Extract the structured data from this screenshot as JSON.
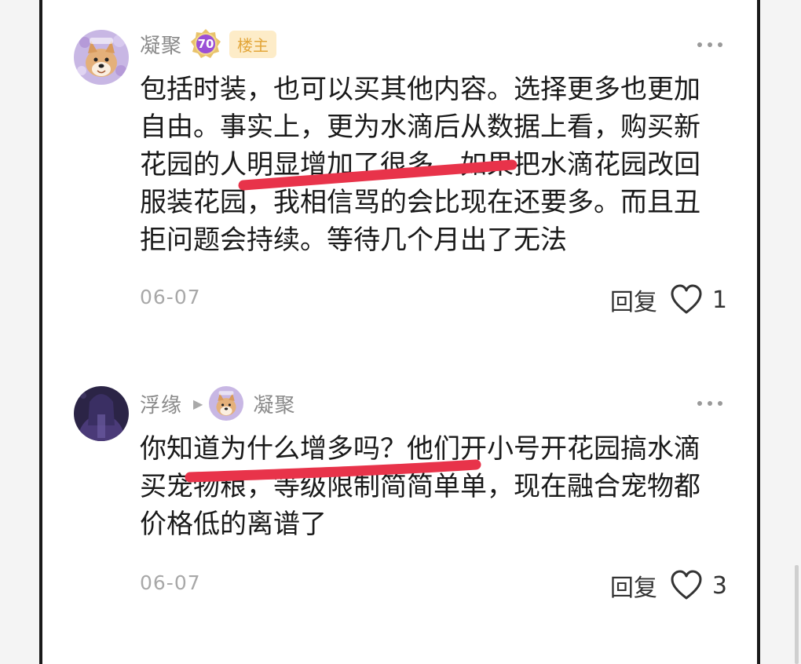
{
  "comments": [
    {
      "username": "凝聚",
      "level": "70",
      "owner_badge": "楼主",
      "body": "包括时装，也可以买其他内容。选择更多也更加自由。事实上，更为水滴后从数据上看，购买新花园的人明显增加了很多。如果把水滴花园改回服装花园，我相信骂的会比现在还要多。而且丑拒问题会持续。等待几个月出了无法",
      "date": "06-07",
      "reply_label": "回复",
      "like_count": "1"
    },
    {
      "username": "浮缘",
      "reply_to_username": "凝聚",
      "body": "你知道为什么增多吗？他们开小号开花园搞水滴买宠物粮，等级限制简简单单，现在融合宠物都价格低的离谱了",
      "date": "06-07",
      "reply_label": "回复",
      "like_count": "3"
    }
  ],
  "colors": {
    "highlight_marker": "#e8334a",
    "owner_badge_bg": "#fdecc8",
    "owner_badge_text": "#e3a63a",
    "level_badge": "#9b4fd6"
  },
  "icons": {
    "more": "more-dots-icon",
    "like": "heart-outline-icon",
    "level": "level-badge-icon",
    "arrow": "triangle-right-icon"
  }
}
